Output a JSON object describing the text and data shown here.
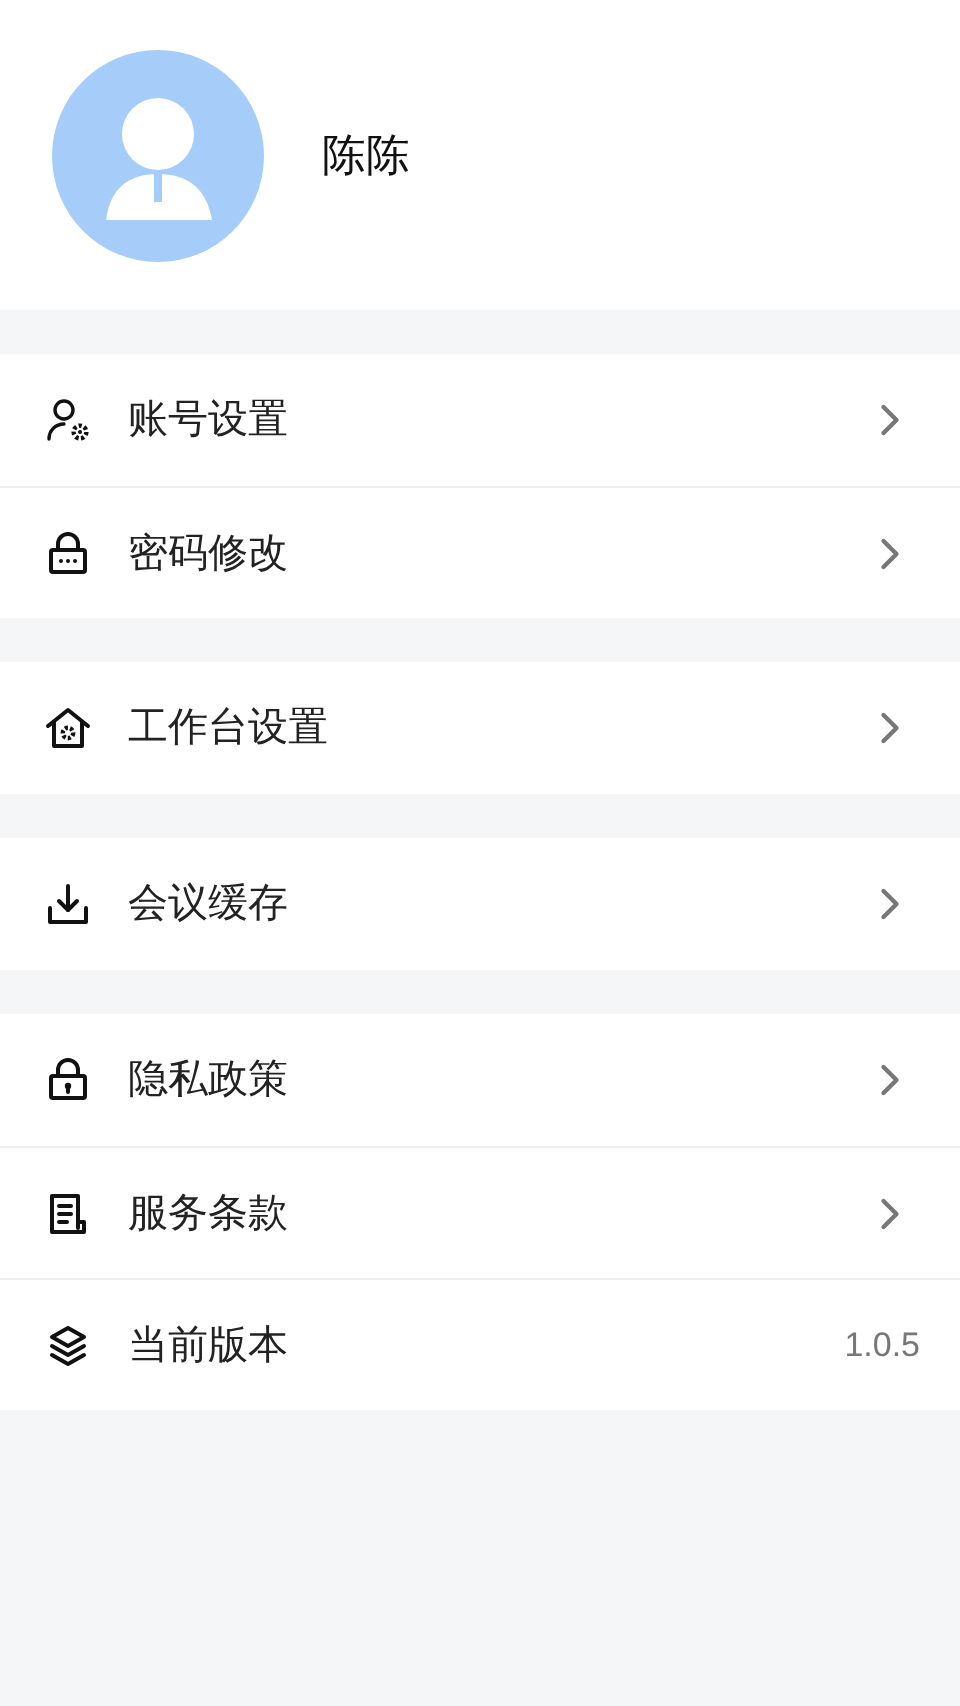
{
  "profile": {
    "name": "陈陈"
  },
  "groups": [
    {
      "items": [
        {
          "label": "账号设置",
          "kind": "link"
        },
        {
          "label": "密码修改",
          "kind": "link"
        }
      ]
    },
    {
      "items": [
        {
          "label": "工作台设置",
          "kind": "link"
        }
      ]
    },
    {
      "items": [
        {
          "label": "会议缓存",
          "kind": "link"
        }
      ]
    },
    {
      "items": [
        {
          "label": "隐私政策",
          "kind": "link"
        },
        {
          "label": "服务条款",
          "kind": "link"
        },
        {
          "label": "当前版本",
          "kind": "value",
          "value": "1.0.5"
        }
      ]
    }
  ]
}
